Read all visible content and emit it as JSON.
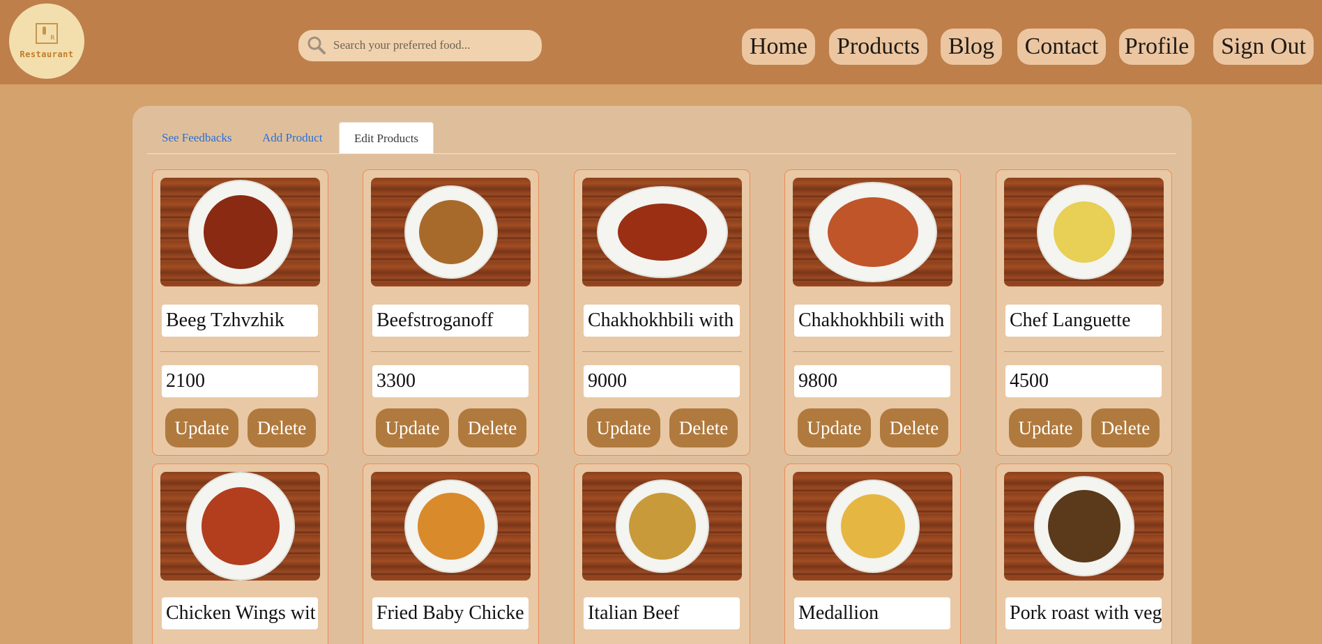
{
  "header": {
    "logo_text": "Restaurant",
    "search": {
      "placeholder": "Search your preferred food..."
    },
    "nav": [
      {
        "label": "Home"
      },
      {
        "label": "Products"
      },
      {
        "label": "Blog"
      },
      {
        "label": "Contact"
      },
      {
        "label": "Profile"
      },
      {
        "label": "Sign Out"
      }
    ]
  },
  "tabs": [
    {
      "label": "See Feedbacks",
      "active": false
    },
    {
      "label": "Add Product",
      "active": false
    },
    {
      "label": "Edit Products",
      "active": true
    }
  ],
  "buttons": {
    "update": "Update",
    "delete": "Delete"
  },
  "products": [
    {
      "name": "Beeg Tzhvzhik",
      "price": "2100",
      "food_color": "#8a2a12"
    },
    {
      "name": "Beefstroganoff",
      "price": "3300",
      "food_color": "#a86a2a"
    },
    {
      "name": "Chakhokhbili with",
      "price": "9000",
      "food_color": "#9a2f14"
    },
    {
      "name": "Chakhokhbili with",
      "price": "9800",
      "food_color": "#c0552a"
    },
    {
      "name": "Chef Languette",
      "price": "4500",
      "food_color": "#e8cf55"
    },
    {
      "name": "Chicken Wings wit",
      "price": "",
      "food_color": "#b23e1e"
    },
    {
      "name": "Fried Baby Chicke",
      "price": "",
      "food_color": "#d98a2a"
    },
    {
      "name": "Italian Beef",
      "price": "",
      "food_color": "#c99a3a"
    },
    {
      "name": "Medallion",
      "price": "",
      "food_color": "#e6b642"
    },
    {
      "name": "Pork roast with veg",
      "price": "",
      "food_color": "#5a3a1a"
    }
  ],
  "colors": {
    "background": "#d4a26c",
    "header": "#be7f4b",
    "panel": "#dfbf9b",
    "card_border": "#ec8a55",
    "button": "#b07a3e",
    "nav_pill": "#ebc6a1"
  }
}
